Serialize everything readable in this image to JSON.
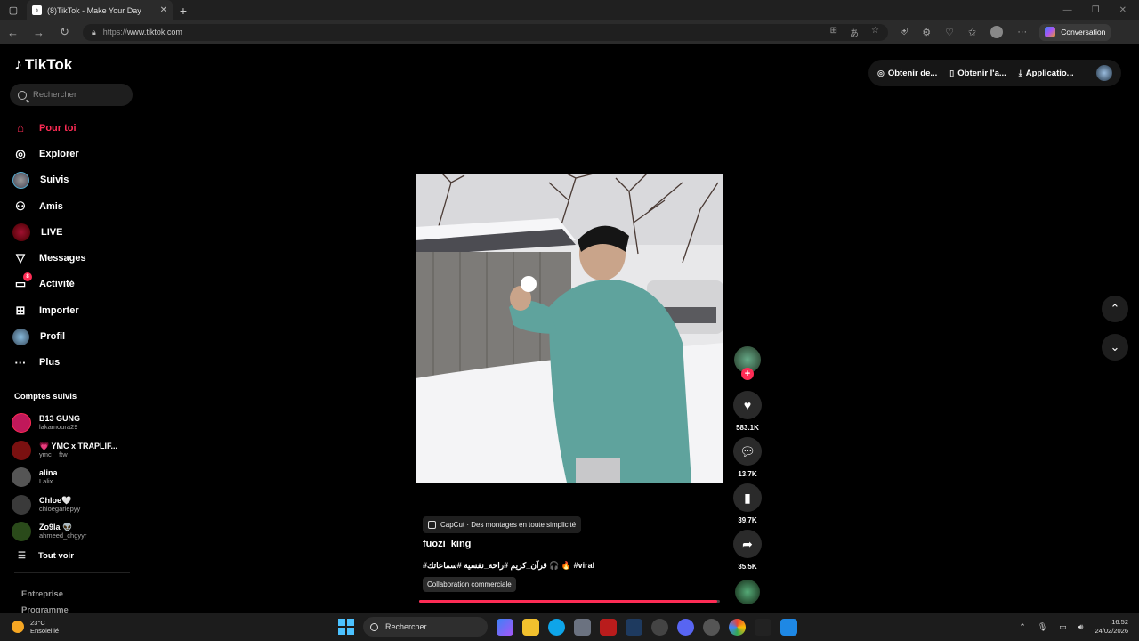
{
  "browser": {
    "tab_title": "(8)TikTok - Make Your Day",
    "tab_favicon": "TikTok",
    "url_prefix": "https://",
    "url_host": "www.tiktok.com",
    "conversation_label": "Conversation"
  },
  "tiktok": {
    "logo_text": "TikTok",
    "search_placeholder": "Rechercher",
    "nav": [
      {
        "label": "Pour toi",
        "icon": "home-icon"
      },
      {
        "label": "Explorer",
        "icon": "compass-icon"
      },
      {
        "label": "Suivis",
        "icon": "following-avatar-icon"
      },
      {
        "label": "Amis",
        "icon": "friends-icon"
      },
      {
        "label": "LIVE",
        "icon": "live-icon"
      },
      {
        "label": "Messages",
        "icon": "send-icon"
      },
      {
        "label": "Activité",
        "icon": "activity-icon",
        "badge": "8"
      },
      {
        "label": "Importer",
        "icon": "upload-icon"
      },
      {
        "label": "Profil",
        "icon": "profile-avatar-icon"
      },
      {
        "label": "Plus",
        "icon": "more-icon"
      }
    ],
    "following_title": "Comptes suivis",
    "following": [
      {
        "name": "B13 GUNG",
        "handle": "lakamoura29",
        "color": "#c0185a"
      },
      {
        "name": "💗 YMC x TRAPLIF...",
        "handle": "ymc__ftw",
        "color": "#7a1010"
      },
      {
        "name": "alina",
        "handle": "Lalix",
        "color": "#555555"
      },
      {
        "name": "Chloe🤍",
        "handle": "chloegariepyy",
        "color": "#3a3a3a"
      },
      {
        "name": "Zo9la 👽",
        "handle": "ahmeed_chgyyr",
        "color": "#2a4a1a"
      }
    ],
    "see_all": "Tout voir",
    "footer": [
      "Entreprise",
      "Programme"
    ],
    "top_actions": [
      {
        "label": "Obtenir de...",
        "icon": "coin-icon"
      },
      {
        "label": "Obtenir l'a...",
        "icon": "phone-icon"
      },
      {
        "label": "Applicatio...",
        "icon": "download-icon"
      }
    ],
    "video": {
      "capcut_label": "CapCut · Des montages en toute simplicité",
      "author": "fuozi_king",
      "caption": "#قرآن_كريم #راحة_نفسية #سماعاتك 🎧 🔥 #viral",
      "collab": "Collaboration commerciale",
      "progress": 0.99
    },
    "stats": {
      "likes": "583.1K",
      "comments": "13.7K",
      "saves": "39.7K",
      "shares": "35.5K"
    },
    "accent": "#fe2c55"
  },
  "taskbar": {
    "temp": "23°C",
    "weather": "Ensoleillé",
    "search": "Rechercher",
    "time": "16:52",
    "date": "24/02/2026"
  }
}
